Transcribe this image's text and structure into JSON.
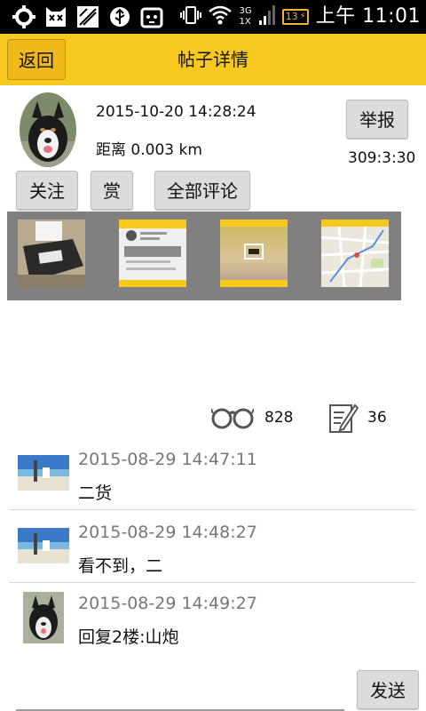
{
  "status_bar": {
    "network_top": "3G",
    "network_bottom": "1X",
    "battery": "13",
    "time": "上午 11:01"
  },
  "header": {
    "back_label": "返回",
    "title": "帖子详情"
  },
  "post": {
    "timestamp": "2015-10-20 14:28:24",
    "distance": "距离 0.003 km",
    "report_label": "举报",
    "stat_text": "309:3:30",
    "actions": {
      "follow_label": "关注",
      "reward_label": "赏",
      "all_comments_label": "全部评论"
    },
    "view_count": "828",
    "comment_count": "36"
  },
  "comments": [
    {
      "time": "2015-08-29 14:47:11",
      "text": "二货"
    },
    {
      "time": "2015-08-29 14:48:27",
      "text": "看不到，二"
    },
    {
      "time": "2015-08-29 14:49:27",
      "text": "回复2楼:山炮"
    }
  ],
  "composer": {
    "send_label": "发送"
  }
}
